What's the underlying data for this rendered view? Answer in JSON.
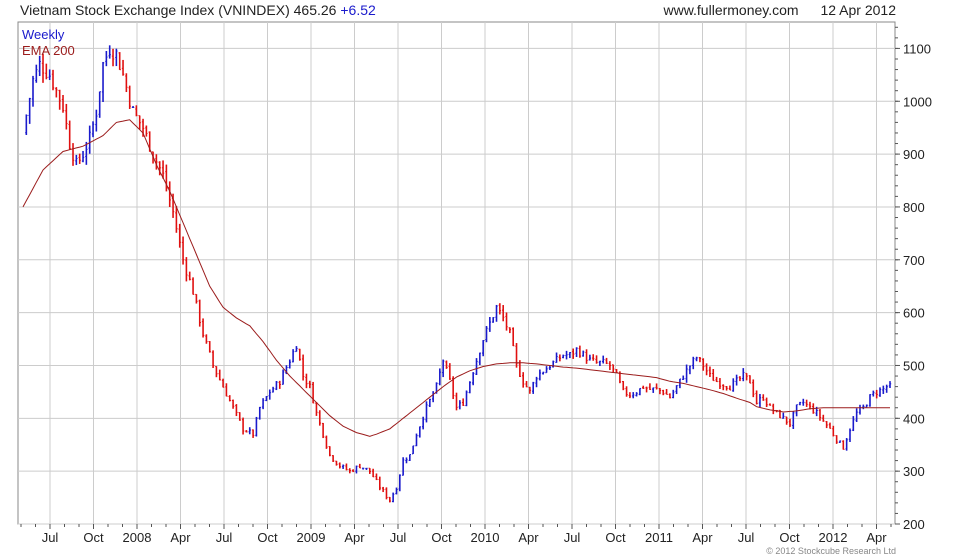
{
  "header": {
    "title": "Vietnam Stock Exchange Index (VNINDEX) 465.26",
    "change": "+6.52",
    "site": "www.fullermoney.com",
    "date": "12 Apr 2012"
  },
  "footer": {
    "copyright": "© 2012 Stockcube Research Ltd"
  },
  "colors": {
    "up": "#1a1acc",
    "down": "#e01010",
    "ema": "#9b1c1c",
    "grid": "#cccccc",
    "frame": "#888888"
  },
  "chart_data": {
    "type": "candlestick",
    "title": "Vietnam Stock Exchange Index (VNINDEX)",
    "interval": "Weekly",
    "legend": [
      {
        "label": "Weekly",
        "color": "#1a1acc"
      },
      {
        "label": "EMA 200",
        "color": "#9b1c1c"
      }
    ],
    "legend_position": "top-left",
    "y_axis": {
      "side": "right",
      "min": 200,
      "max": 1150,
      "ticks": [
        200,
        300,
        400,
        500,
        600,
        700,
        800,
        900,
        1000,
        1100
      ]
    },
    "x_axis": {
      "ticks": [
        "Jul",
        "Oct",
        "2008",
        "Apr",
        "Jul",
        "Oct",
        "2009",
        "Apr",
        "Jul",
        "Oct",
        "2010",
        "Apr",
        "Jul",
        "Oct",
        "2011",
        "Apr",
        "Jul",
        "Oct",
        "2012",
        "Apr"
      ]
    },
    "grid": true,
    "last_close": 465.26,
    "change": 6.52,
    "close_anchors": [
      [
        0,
        940
      ],
      [
        3,
        1040
      ],
      [
        5,
        1070
      ],
      [
        8,
        1050
      ],
      [
        10,
        1020
      ],
      [
        12,
        990
      ],
      [
        14,
        920
      ],
      [
        16,
        880
      ],
      [
        18,
        900
      ],
      [
        20,
        930
      ],
      [
        22,
        980
      ],
      [
        24,
        1070
      ],
      [
        26,
        1100
      ],
      [
        28,
        1090
      ],
      [
        30,
        1050
      ],
      [
        33,
        980
      ],
      [
        36,
        950
      ],
      [
        39,
        900
      ],
      [
        42,
        860
      ],
      [
        45,
        790
      ],
      [
        48,
        700
      ],
      [
        51,
        640
      ],
      [
        54,
        560
      ],
      [
        57,
        500
      ],
      [
        60,
        460
      ],
      [
        63,
        420
      ],
      [
        66,
        380
      ],
      [
        69,
        370
      ],
      [
        71,
        420
      ],
      [
        74,
        450
      ],
      [
        77,
        470
      ],
      [
        80,
        510
      ],
      [
        82,
        540
      ],
      [
        84,
        480
      ],
      [
        86,
        460
      ],
      [
        88,
        410
      ],
      [
        90,
        370
      ],
      [
        92,
        330
      ],
      [
        95,
        310
      ],
      [
        98,
        300
      ],
      [
        101,
        310
      ],
      [
        104,
        300
      ],
      [
        107,
        270
      ],
      [
        110,
        245
      ],
      [
        112,
        270
      ],
      [
        114,
        320
      ],
      [
        116,
        330
      ],
      [
        118,
        370
      ],
      [
        121,
        420
      ],
      [
        124,
        460
      ],
      [
        126,
        510
      ],
      [
        128,
        470
      ],
      [
        130,
        420
      ],
      [
        132,
        430
      ],
      [
        134,
        470
      ],
      [
        136,
        510
      ],
      [
        138,
        550
      ],
      [
        140,
        580
      ],
      [
        142,
        610
      ],
      [
        144,
        590
      ],
      [
        146,
        560
      ],
      [
        148,
        500
      ],
      [
        150,
        470
      ],
      [
        152,
        450
      ],
      [
        154,
        480
      ],
      [
        156,
        490
      ],
      [
        158,
        500
      ],
      [
        160,
        510
      ],
      [
        162,
        520
      ],
      [
        164,
        520
      ],
      [
        166,
        530
      ],
      [
        168,
        520
      ],
      [
        170,
        510
      ],
      [
        172,
        505
      ],
      [
        174,
        505
      ],
      [
        176,
        500
      ],
      [
        178,
        480
      ],
      [
        180,
        450
      ],
      [
        182,
        445
      ],
      [
        184,
        450
      ],
      [
        186,
        460
      ],
      [
        188,
        455
      ],
      [
        190,
        455
      ],
      [
        192,
        450
      ],
      [
        194,
        440
      ],
      [
        196,
        460
      ],
      [
        198,
        480
      ],
      [
        200,
        500
      ],
      [
        202,
        515
      ],
      [
        204,
        500
      ],
      [
        206,
        480
      ],
      [
        208,
        470
      ],
      [
        210,
        465
      ],
      [
        212,
        460
      ],
      [
        214,
        470
      ],
      [
        216,
        480
      ],
      [
        218,
        470
      ],
      [
        220,
        430
      ],
      [
        222,
        440
      ],
      [
        224,
        420
      ],
      [
        226,
        410
      ],
      [
        228,
        400
      ],
      [
        230,
        390
      ],
      [
        232,
        420
      ],
      [
        234,
        430
      ],
      [
        236,
        420
      ],
      [
        238,
        410
      ],
      [
        240,
        395
      ],
      [
        242,
        380
      ],
      [
        244,
        360
      ],
      [
        246,
        345
      ],
      [
        248,
        380
      ],
      [
        250,
        410
      ],
      [
        252,
        420
      ],
      [
        254,
        440
      ],
      [
        256,
        450
      ],
      [
        258,
        455
      ],
      [
        260,
        465
      ]
    ],
    "ema200_anchors": [
      [
        0,
        800
      ],
      [
        6,
        870
      ],
      [
        12,
        905
      ],
      [
        18,
        915
      ],
      [
        24,
        935
      ],
      [
        28,
        960
      ],
      [
        32,
        965
      ],
      [
        36,
        940
      ],
      [
        40,
        880
      ],
      [
        44,
        830
      ],
      [
        48,
        770
      ],
      [
        52,
        710
      ],
      [
        56,
        650
      ],
      [
        60,
        610
      ],
      [
        64,
        590
      ],
      [
        68,
        575
      ],
      [
        72,
        545
      ],
      [
        76,
        510
      ],
      [
        80,
        480
      ],
      [
        84,
        455
      ],
      [
        88,
        430
      ],
      [
        92,
        405
      ],
      [
        96,
        385
      ],
      [
        100,
        373
      ],
      [
        104,
        366
      ],
      [
        106,
        370
      ],
      [
        110,
        380
      ],
      [
        114,
        400
      ],
      [
        118,
        420
      ],
      [
        122,
        440
      ],
      [
        126,
        460
      ],
      [
        130,
        478
      ],
      [
        134,
        490
      ],
      [
        138,
        498
      ],
      [
        142,
        503
      ],
      [
        146,
        505
      ],
      [
        150,
        505
      ],
      [
        154,
        503
      ],
      [
        158,
        500
      ],
      [
        162,
        497
      ],
      [
        166,
        495
      ],
      [
        170,
        492
      ],
      [
        174,
        489
      ],
      [
        178,
        486
      ],
      [
        182,
        483
      ],
      [
        186,
        480
      ],
      [
        190,
        477
      ],
      [
        194,
        470
      ],
      [
        198,
        466
      ],
      [
        202,
        460
      ],
      [
        206,
        454
      ],
      [
        210,
        447
      ],
      [
        214,
        438
      ],
      [
        218,
        430
      ],
      [
        220,
        422
      ],
      [
        224,
        416
      ],
      [
        228,
        412
      ],
      [
        232,
        414
      ],
      [
        236,
        418
      ],
      [
        240,
        420
      ],
      [
        260,
        420
      ]
    ]
  }
}
